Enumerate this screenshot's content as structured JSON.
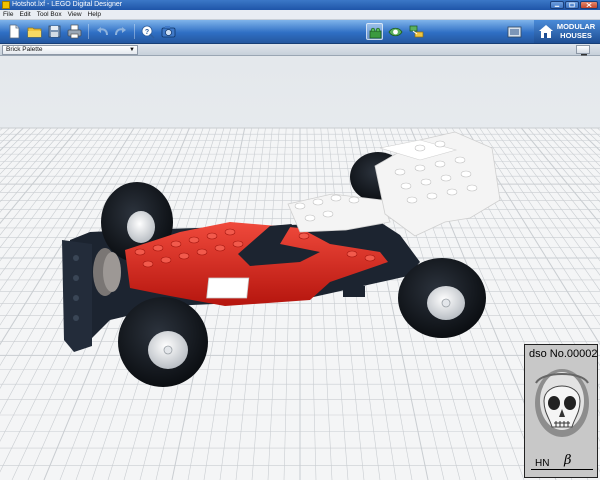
{
  "window": {
    "title": "Hotshot.lxf - LEGO Digital Designer",
    "controls": [
      "minimize",
      "maximize",
      "close"
    ]
  },
  "menubar": {
    "items": [
      "File",
      "Edit",
      "Tool Box",
      "View",
      "Help"
    ]
  },
  "toolbar": {
    "tools": [
      {
        "icon": "new-file-icon"
      },
      {
        "icon": "open-folder-icon"
      },
      {
        "icon": "save-icon"
      },
      {
        "icon": "print-icon"
      },
      {
        "icon": "undo-icon"
      },
      {
        "icon": "redo-icon"
      },
      {
        "icon": "help-icon"
      },
      {
        "icon": "camera-icon"
      }
    ],
    "modes": [
      {
        "icon": "build-mode-icon",
        "selected": true
      },
      {
        "icon": "view-mode-icon",
        "selected": false
      },
      {
        "icon": "building-guide-icon",
        "selected": false
      }
    ],
    "theme_button": {
      "label": "MODULAR HOUSES",
      "icon": "house-icon"
    }
  },
  "palette": {
    "selected": "Brick Palette"
  },
  "watermark": {
    "id_text": "dso No.00002",
    "signature": "HN",
    "beta": "β"
  },
  "colors": {
    "accent": "#2f6fc4",
    "brick_red": "#d8261c",
    "brick_white": "#f4f4f4",
    "brick_dark": "#1c2430",
    "grid": "#c9cdd1"
  }
}
